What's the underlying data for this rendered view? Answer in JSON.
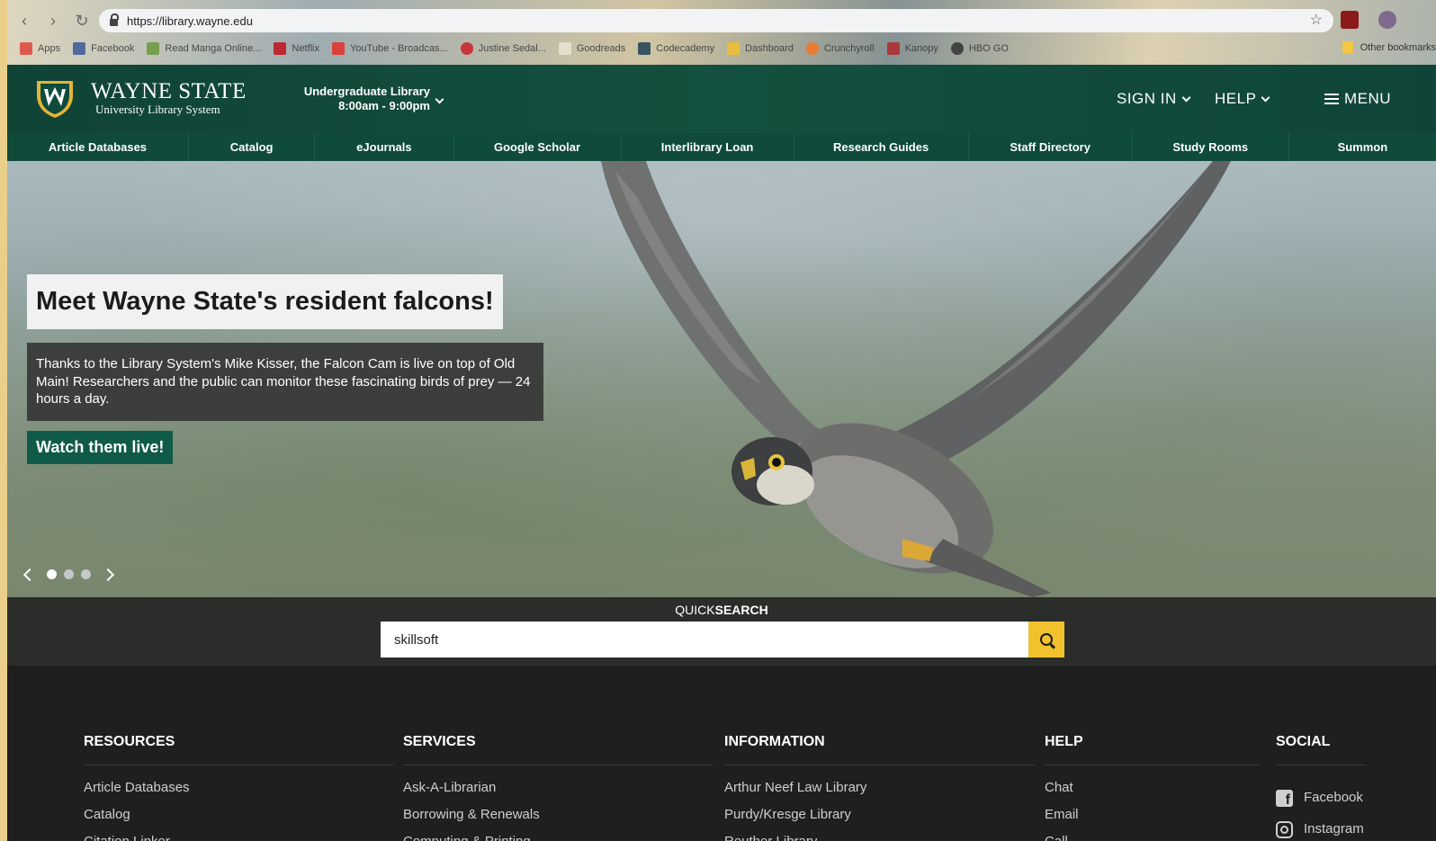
{
  "browser": {
    "url": "https://library.wayne.edu",
    "bookmarks": [
      "Apps",
      "Facebook",
      "Read Manga Online...",
      "Netflix",
      "YouTube - Broadcas...",
      "Justine Sedal...",
      "Goodreads",
      "Codecademy",
      "Dashboard",
      "Crunchyroll",
      "Kanopy",
      "HBO GO"
    ],
    "other_bookmarks": "Other bookmarks"
  },
  "header": {
    "logo_title": "WAYNE STATE",
    "logo_subtitle": "University Library System",
    "library_name": "Undergraduate Library",
    "library_hours": "8:00am - 9:00pm",
    "sign_in": "SIGN IN",
    "help": "HELP",
    "menu": "MENU"
  },
  "nav": {
    "items": [
      {
        "label": "Article Databases"
      },
      {
        "label": "Catalog"
      },
      {
        "label": "eJournals"
      },
      {
        "label": "Google Scholar"
      },
      {
        "label": "Interlibrary Loan"
      },
      {
        "label": "Research Guides"
      },
      {
        "label": "Staff Directory"
      },
      {
        "label": "Study Rooms"
      },
      {
        "label": "Summon"
      }
    ]
  },
  "hero": {
    "title": "Meet Wayne State's resident falcons!",
    "text": "Thanks to the Library System's Mike Kisser, the Falcon Cam is live on top of Old Main! Researchers and the public can monitor these fascinating birds of prey — 24 hours a day.",
    "cta": "Watch them live!",
    "slide_count": 3,
    "active_slide": 1
  },
  "quicksearch": {
    "label_light": "QUICK",
    "label_bold": "SEARCH",
    "value": "skillsoft"
  },
  "footer": {
    "resources": {
      "title": "RESOURCES",
      "items": [
        "Article Databases",
        "Catalog",
        "Citation Linker"
      ]
    },
    "services": {
      "title": "SERVICES",
      "items": [
        "Ask-A-Librarian",
        "Borrowing & Renewals",
        "Computing & Printing"
      ]
    },
    "information": {
      "title": "INFORMATION",
      "items": [
        "Arthur Neef Law Library",
        "Purdy/Kresge Library",
        "Reuther Library"
      ]
    },
    "help": {
      "title": "HELP",
      "items": [
        "Chat",
        "Email",
        "Call"
      ]
    },
    "social": {
      "title": "SOCIAL",
      "items": [
        "Facebook",
        "Instagram"
      ]
    }
  },
  "colors": {
    "brand_green": "#0f4a3b",
    "accent_gold": "#f2c12e"
  }
}
